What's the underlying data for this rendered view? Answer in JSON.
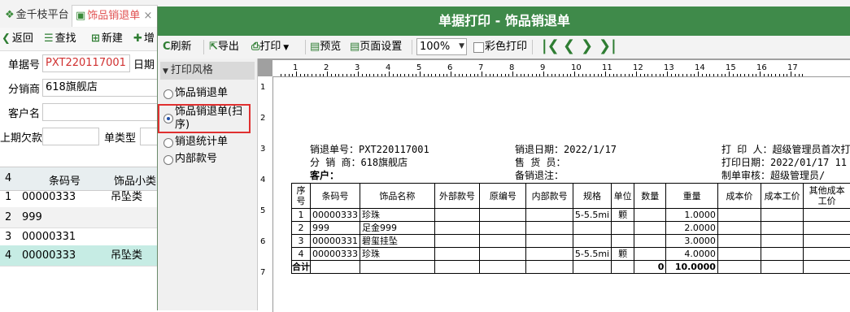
{
  "tabs": {
    "platform": "金千枝平台",
    "current": "饰品销退单",
    "close": "×"
  },
  "toolbar": {
    "back": "返回",
    "search": "查找",
    "new": "新建",
    "add": "增"
  },
  "form": {
    "bill_no_label": "单据号",
    "bill_no_value": "PXT220117001",
    "date_label": "日期",
    "distributor_label": "分销商",
    "distributor_value": "618旗舰店",
    "customer_label": "客户名",
    "prev_debt_label": "上期欠款",
    "bill_type_label": "单类型"
  },
  "grid": {
    "count": "4",
    "col_code": "条码号",
    "col_category": "饰品小类",
    "rows": [
      {
        "no": "1",
        "code": "00000333",
        "category": "吊坠类"
      },
      {
        "no": "2",
        "code": "999",
        "category": ""
      },
      {
        "no": "3",
        "code": "00000331",
        "category": ""
      },
      {
        "no": "4",
        "code": "00000333",
        "category": "吊坠类"
      }
    ]
  },
  "dialog": {
    "title": "单据打印 - 饰品销退单",
    "toolbar": {
      "refresh": "刷新",
      "export": "导出",
      "print": "打印",
      "preview": "预览",
      "page_setup": "页面设置",
      "zoom": "100%",
      "color_print": "彩色打印"
    },
    "panel_title": "打印风格",
    "styles": [
      {
        "label": "饰品销退单",
        "selected": false
      },
      {
        "label": "饰品销退单(扫序)",
        "selected": true
      },
      {
        "label": "销退统计单",
        "selected": false
      },
      {
        "label": "内部款号",
        "selected": false
      }
    ]
  },
  "report": {
    "info_left": [
      "销退单号：PXT220117001",
      "分 销 商：618旗舰店",
      "客户："
    ],
    "info_mid": [
      "销退日期：2022/1/17",
      "售 货 员：",
      "备销退注："
    ],
    "info_right": [
      "打 印 人：超级管理员首次打",
      "打印日期：2022/01/17 11",
      "制单审核：超级管理员/"
    ],
    "columns": [
      "序号",
      "条码号",
      "饰品名称",
      "外部款号",
      "原编号",
      "内部款号",
      "规格",
      "单位",
      "数量",
      "重量",
      "成本价",
      "成本工价",
      "其他成本工价"
    ],
    "rows": [
      [
        "1",
        "00000333",
        "珍珠",
        "",
        "",
        "",
        "5-5.5mi",
        "颗",
        "",
        "1.0000",
        "",
        "",
        ""
      ],
      [
        "2",
        "999",
        "足金999",
        "",
        "",
        "",
        "",
        "",
        "",
        "2.0000",
        "",
        "",
        ""
      ],
      [
        "3",
        "00000331",
        "碧玺挂坠",
        "",
        "",
        "",
        "",
        "",
        "",
        "3.0000",
        "",
        "",
        ""
      ],
      [
        "4",
        "00000333",
        "珍珠",
        "",
        "",
        "",
        "5-5.5mi",
        "颗",
        "",
        "4.0000",
        "",
        "",
        ""
      ]
    ],
    "total_label": "合计",
    "total_qty": "0",
    "total_weight": "10.0000"
  },
  "rulers": {
    "h": [
      "1",
      "2",
      "3",
      "4",
      "5",
      "6",
      "7",
      "8",
      "9",
      "10",
      "11",
      "12",
      "13",
      "14",
      "15",
      "16",
      "17"
    ],
    "v": [
      "1",
      "2",
      "3",
      "4",
      "5",
      "6",
      "7"
    ]
  },
  "colors": {
    "title_bar": "#3f8a4a",
    "accent_green": "#2e7d32",
    "highlight_red": "#e03030",
    "selected_row": "#c6ece4"
  }
}
